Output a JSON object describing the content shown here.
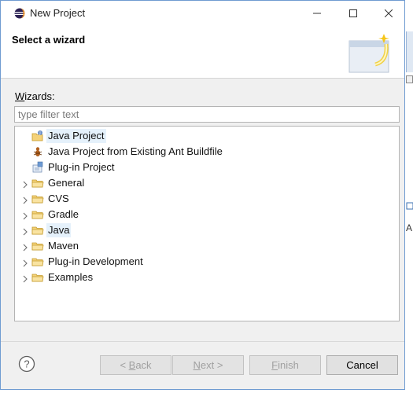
{
  "window": {
    "title": "New Project"
  },
  "header": {
    "title": "Select a wizard"
  },
  "wizards": {
    "label_mnemonic": "W",
    "label_rest": "izards:",
    "filter_placeholder": "type filter text"
  },
  "tree": [
    {
      "label": "Java Project",
      "icon": "java-project-icon",
      "expandable": false,
      "selected": true
    },
    {
      "label": "Java Project from Existing Ant Buildfile",
      "icon": "ant-project-icon",
      "expandable": false,
      "selected": false
    },
    {
      "label": "Plug-in Project",
      "icon": "plugin-project-icon",
      "expandable": false,
      "selected": false
    },
    {
      "label": "General",
      "icon": "folder-icon",
      "expandable": true,
      "selected": false
    },
    {
      "label": "CVS",
      "icon": "folder-icon",
      "expandable": true,
      "selected": false
    },
    {
      "label": "Gradle",
      "icon": "folder-icon",
      "expandable": true,
      "selected": false
    },
    {
      "label": "Java",
      "icon": "folder-icon",
      "expandable": true,
      "selected": true
    },
    {
      "label": "Maven",
      "icon": "folder-icon",
      "expandable": true,
      "selected": false
    },
    {
      "label": "Plug-in Development",
      "icon": "folder-icon",
      "expandable": true,
      "selected": false
    },
    {
      "label": "Examples",
      "icon": "folder-icon",
      "expandable": true,
      "selected": false
    }
  ],
  "buttons": {
    "back_prefix": "< ",
    "back_mnemonic": "B",
    "back_rest": "ack",
    "next_mnemonic": "N",
    "next_rest": "ext >",
    "finish_mnemonic": "F",
    "finish_rest": "inish",
    "cancel": "Cancel"
  },
  "background_window": {
    "partial_text": "A"
  }
}
